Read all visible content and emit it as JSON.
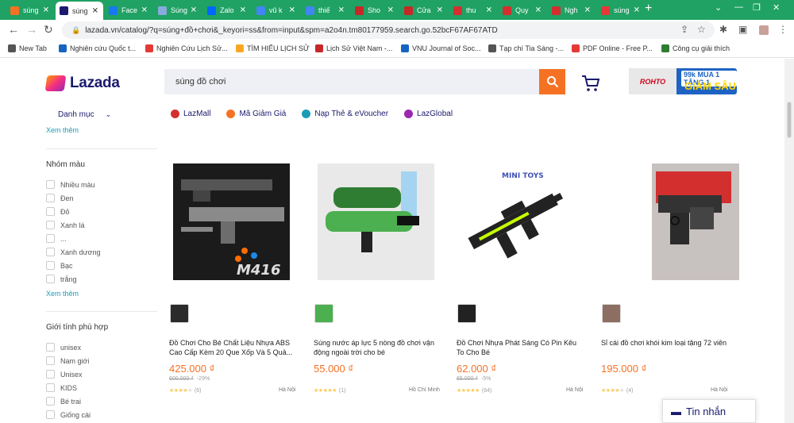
{
  "browser": {
    "tabs": [
      {
        "label": "súng",
        "color": "#f57224"
      },
      {
        "label": "súng",
        "color": "#1a1a6e"
      },
      {
        "label": "Face",
        "color": "#1877f2"
      },
      {
        "label": "Súng",
        "color": "#8ad"
      },
      {
        "label": "Zalo",
        "color": "#0068ff"
      },
      {
        "label": "vũ k",
        "color": "#4285f4"
      },
      {
        "label": "thiế",
        "color": "#4285f4"
      },
      {
        "label": "Sho",
        "color": "#c62828"
      },
      {
        "label": "Cửa",
        "color": "#c62828"
      },
      {
        "label": "thu",
        "color": "#d32f2f"
      },
      {
        "label": "Quy",
        "color": "#d32f2f"
      },
      {
        "label": "Ngh",
        "color": "#d32f2f"
      },
      {
        "label": "súng",
        "color": "#e53935"
      }
    ],
    "new_tab_symbol": "+",
    "url": "lazada.vn/catalog/?q=súng+đồ+chơi&_keyori=ss&from=input&spm=a2o4n.tm80177959.search.go.52bcF67AF67ATD",
    "bookmarks": [
      {
        "label": "New Tab",
        "color": "#555"
      },
      {
        "label": "Nghiên cứu Quốc t...",
        "color": "#1565c0"
      },
      {
        "label": "Nghiên Cứu Lịch Sử...",
        "color": "#e53935"
      },
      {
        "label": "TÌM HIỂU LỊCH SỬ",
        "color": "#f9a825"
      },
      {
        "label": "Lịch Sử Việt Nam -...",
        "color": "#c62828"
      },
      {
        "label": "VNU Journal of Soc...",
        "color": "#1565c0"
      },
      {
        "label": "Tạp chí Tia Sáng -...",
        "color": "#555"
      },
      {
        "label": "PDF Online - Free P...",
        "color": "#e53935"
      },
      {
        "label": "Công cụ giải thích",
        "color": "#2e7d32"
      }
    ]
  },
  "header": {
    "logo_text": "Lazada",
    "search_value": "súng đồ chơi",
    "promo_brand": "ROHTO",
    "promo_line1": "99k MUA 1 TẶNG 1",
    "promo_line2": "GIẢM SÂU 50%"
  },
  "nav": {
    "category_label": "Danh mục",
    "quick_links": [
      {
        "label": "LazMall",
        "color": "#d32f2f"
      },
      {
        "label": "Mã Giảm Giá",
        "color": "#f57224"
      },
      {
        "label": "Nạp Thẻ & eVoucher",
        "color": "#1a9cb7"
      },
      {
        "label": "LazGlobal",
        "color": "#9b27b0"
      }
    ]
  },
  "sidebar": {
    "see_more": "Xem thêm",
    "color_group": {
      "title": "Nhóm màu",
      "options": [
        "Nhiều màu",
        "Đen",
        "Đỏ",
        "Xanh lá",
        "...",
        "Xanh dương",
        "Bạc",
        "trắng"
      ]
    },
    "gender_group": {
      "title": "Giới tính phù hợp",
      "options": [
        "unisex",
        "Nam giới",
        "Unisex",
        "KIDS",
        "Bé trai",
        "Giống cái"
      ]
    }
  },
  "products": [
    {
      "title": "Đồ Chơi Cho Bé Chất Liệu Nhựa ABS Cao Cấp Kèm 20 Que Xốp Và 5 Quả...",
      "price": "425.000 ₫",
      "original": "600.000 ₫",
      "discount": "-29%",
      "rating": 4,
      "reviews": "(6)",
      "location": "Hà Nội",
      "image_label": "M416"
    },
    {
      "title": "Súng nước áp lực 5 nòng đồ chơi vận động ngoài trời cho bé",
      "price": "55.000 ₫",
      "original": "",
      "discount": "",
      "rating": 5,
      "reviews": "(1)",
      "location": "Hồ Chí Minh",
      "image_label": ""
    },
    {
      "title": "Đồ Chơi Nhựa Phát Sáng Có Pin Kêu To Cho Bé",
      "price": "62.000 ₫",
      "original": "65.000 ₫",
      "discount": "-5%",
      "rating": 5,
      "reviews": "(64)",
      "location": "Hà Nội",
      "image_label": "MINI TOYS"
    },
    {
      "title": "Sỉ cái đồ chơi khói kim loại tặng 72 viên",
      "price": "195.000 ₫",
      "original": "",
      "discount": "",
      "rating": 4,
      "reviews": "(4)",
      "location": "Hà Nội",
      "image_label": ""
    }
  ],
  "chat": {
    "label": "Tin nhắn"
  }
}
